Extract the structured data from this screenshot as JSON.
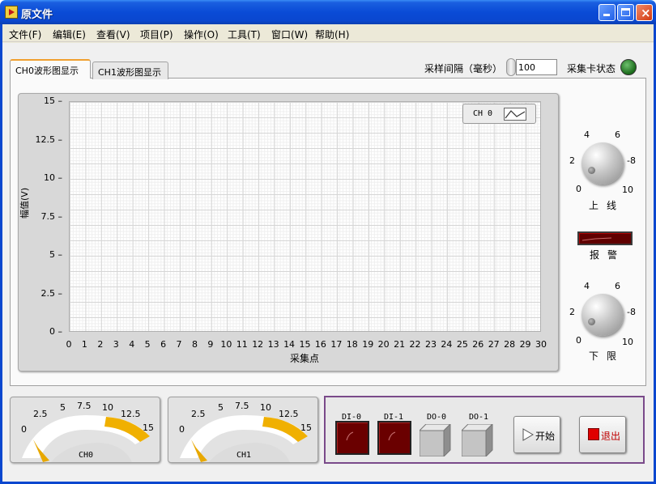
{
  "window": {
    "title": "原文件"
  },
  "menu": [
    {
      "label": "文件(F)"
    },
    {
      "label": "编辑(E)"
    },
    {
      "label": "查看(V)"
    },
    {
      "label": "项目(P)"
    },
    {
      "label": "操作(O)"
    },
    {
      "label": "工具(T)"
    },
    {
      "label": "窗口(W)"
    },
    {
      "label": "帮助(H)"
    }
  ],
  "tabs": [
    {
      "label": "CH0波形图显示",
      "active": true
    },
    {
      "label": "CH1波形图显示",
      "active": false
    }
  ],
  "sampling": {
    "label": "采样间隔（毫秒）",
    "value": "100"
  },
  "card_status": {
    "label": "采集卡状态",
    "on": true,
    "color": "#2a8a2a"
  },
  "chart_data": {
    "type": "line",
    "xlabel": "采集点",
    "ylabel": "幅值(V)",
    "xlim": [
      0,
      30
    ],
    "ylim": [
      0,
      15
    ],
    "x_ticks": [
      "0",
      "1",
      "2",
      "3",
      "4",
      "5",
      "6",
      "7",
      "8",
      "9",
      "10",
      "11",
      "12",
      "13",
      "14",
      "15",
      "16",
      "17",
      "18",
      "19",
      "20",
      "21",
      "22",
      "23",
      "24",
      "25",
      "26",
      "27",
      "28",
      "29",
      "30"
    ],
    "y_ticks": [
      "15",
      "12.5",
      "10",
      "7.5",
      "5",
      "2.5",
      "0"
    ],
    "series": [
      {
        "name": "CH 0",
        "values": []
      }
    ],
    "grid": true,
    "legend": "top-right"
  },
  "upper_knob": {
    "label": "上线",
    "scale": [
      "0",
      "2",
      "4",
      "6",
      "8",
      "10"
    ]
  },
  "lower_knob": {
    "label": "下限",
    "scale": [
      "0",
      "2",
      "4",
      "6",
      "8",
      "10"
    ]
  },
  "alarm": {
    "label": "报警"
  },
  "meters": [
    {
      "name": "CH0",
      "scale": [
        "0",
        "2.5",
        "5",
        "7.5",
        "10",
        "12.5",
        "15"
      ]
    },
    {
      "name": "CH1",
      "scale": [
        "0",
        "2.5",
        "5",
        "7.5",
        "10",
        "12.5",
        "15"
      ]
    }
  ],
  "digital_inputs": [
    {
      "label": "DI-0"
    },
    {
      "label": "DI-1"
    }
  ],
  "digital_outputs": [
    {
      "label": "DO-0"
    },
    {
      "label": "DO-1"
    }
  ],
  "buttons": {
    "start": "开始",
    "exit": "退出"
  },
  "colors": {
    "meter_fill": "#f0b000",
    "led_off": "#6a0000",
    "exit_square": "#e00000"
  }
}
